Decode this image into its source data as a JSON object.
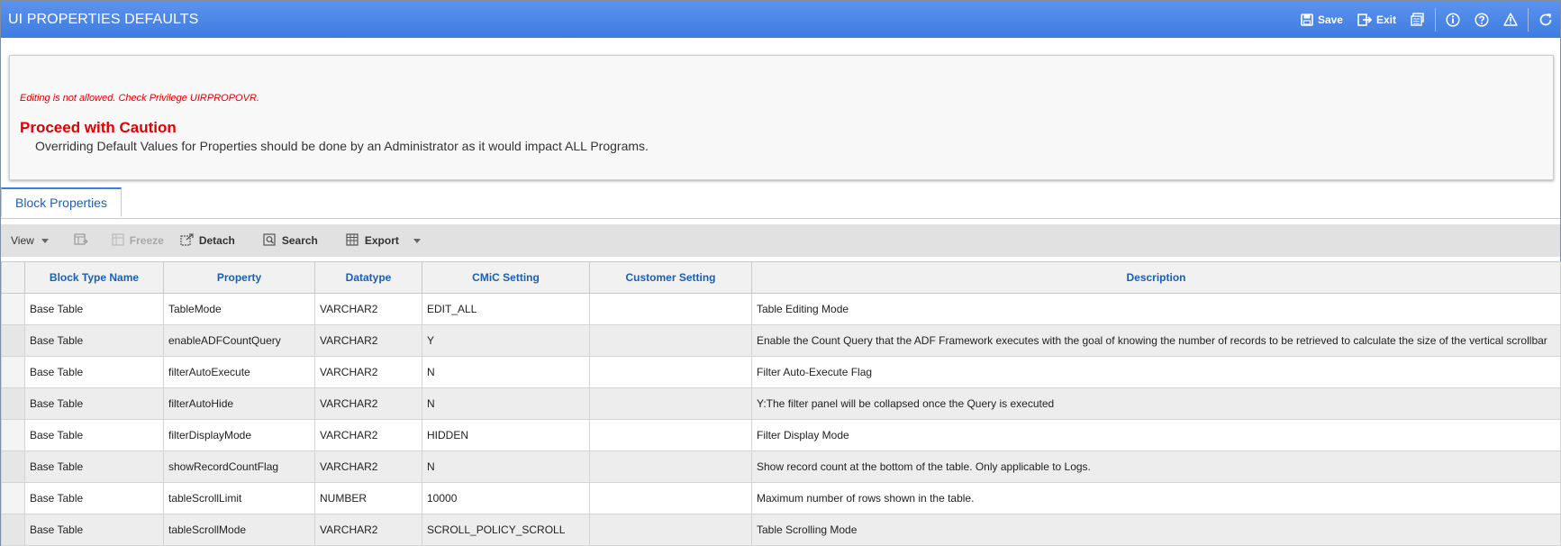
{
  "app": {
    "title": "UI PROPERTIES DEFAULTS"
  },
  "toolbar_top": {
    "save_label": "Save",
    "exit_label": "Exit",
    "icons": [
      "save-icon",
      "exit-icon",
      "print-icon",
      "info-icon",
      "help-icon",
      "warning-icon",
      "refresh-icon"
    ]
  },
  "message": {
    "error": "Editing is not allowed. Check Privilege UIRPROPOVR.",
    "caution_title": "Proceed with Caution",
    "caution_text": "Overriding Default Values for Properties should be done by an Administrator as it would impact ALL Programs."
  },
  "tabs": [
    {
      "label": "Block Properties"
    }
  ],
  "grid_toolbar": {
    "view": "View",
    "freeze": "Freeze",
    "detach": "Detach",
    "search": "Search",
    "export": "Export"
  },
  "table": {
    "columns": [
      "Block Type Name",
      "Property",
      "Datatype",
      "CMiC Setting",
      "Customer Setting",
      "Description"
    ],
    "rows": [
      [
        "Base Table",
        "TableMode",
        "VARCHAR2",
        "EDIT_ALL",
        "",
        "Table Editing Mode"
      ],
      [
        "Base Table",
        "enableADFCountQuery",
        "VARCHAR2",
        "Y",
        "",
        "Enable the Count Query that the ADF Framework executes with the goal of knowing the number of records to be retrieved to calculate the size of the vertical scrollbar"
      ],
      [
        "Base Table",
        "filterAutoExecute",
        "VARCHAR2",
        "N",
        "",
        "Filter Auto-Execute Flag"
      ],
      [
        "Base Table",
        "filterAutoHide",
        "VARCHAR2",
        "N",
        "",
        "Y:The filter panel will be collapsed once the Query is executed"
      ],
      [
        "Base Table",
        "filterDisplayMode",
        "VARCHAR2",
        "HIDDEN",
        "",
        "Filter Display Mode"
      ],
      [
        "Base Table",
        "showRecordCountFlag",
        "VARCHAR2",
        "N",
        "",
        "Show record count at the bottom of the table. Only applicable to Logs."
      ],
      [
        "Base Table",
        "tableScrollLimit",
        "NUMBER",
        "10000",
        "",
        "Maximum number of rows shown in the table."
      ],
      [
        "Base Table",
        "tableScrollMode",
        "VARCHAR2",
        "SCROLL_POLICY_SCROLL",
        "",
        "Table Scrolling Mode"
      ]
    ]
  },
  "colors": {
    "titlebar": "#4a86e8",
    "error": "#e00000",
    "link": "#1a5fb4"
  }
}
